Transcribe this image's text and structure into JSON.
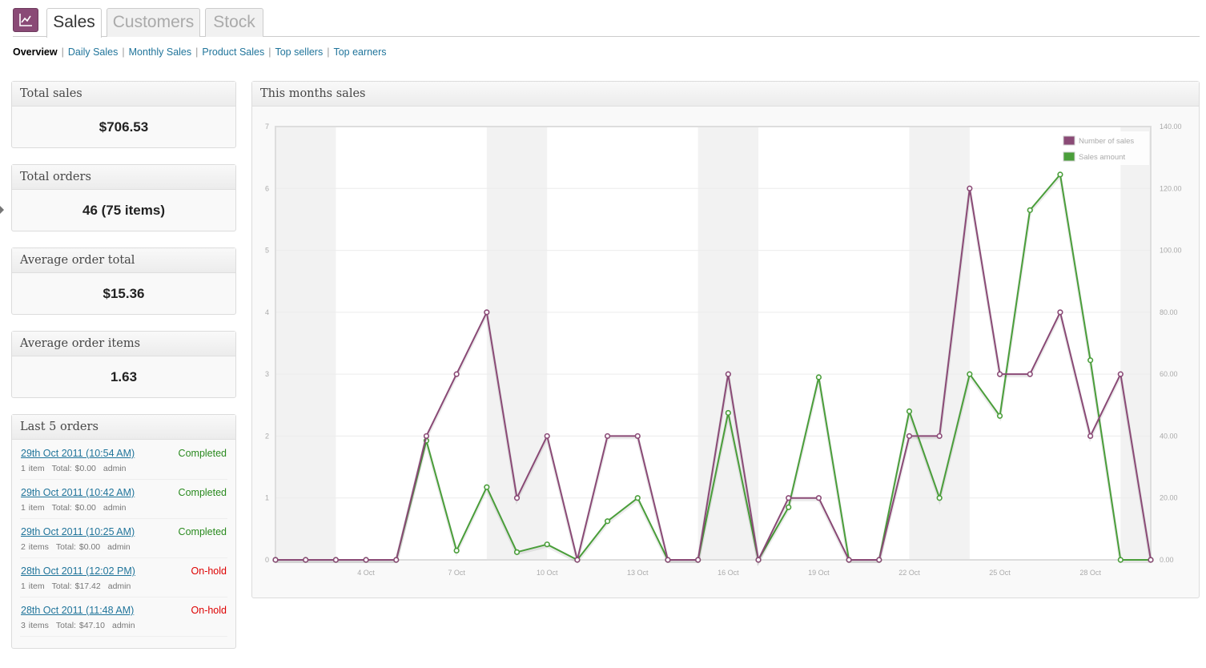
{
  "tabs": [
    {
      "label": "Sales",
      "active": true
    },
    {
      "label": "Customers",
      "active": false
    },
    {
      "label": "Stock",
      "active": false
    }
  ],
  "app_icon": "chart-icon",
  "subnav": [
    "Overview",
    "Daily Sales",
    "Monthly Sales",
    "Product Sales",
    "Top sellers",
    "Top earners"
  ],
  "stats": [
    {
      "title": "Total sales",
      "value": "$706.53"
    },
    {
      "title": "Total orders",
      "value": "46 (75 items)"
    },
    {
      "title": "Average order total",
      "value": "$15.36"
    },
    {
      "title": "Average order items",
      "value": "1.63"
    }
  ],
  "last_orders": {
    "title": "Last 5 orders",
    "orders": [
      {
        "link": "29th Oct 2011 (10:54 AM)",
        "items": "1 item",
        "total": "Total: $0.00",
        "user": "admin",
        "status": "Completed"
      },
      {
        "link": "29th Oct 2011 (10:42 AM)",
        "items": "1 item",
        "total": "Total: $0.00",
        "user": "admin",
        "status": "Completed"
      },
      {
        "link": "29th Oct 2011 (10:25 AM)",
        "items": "2 items",
        "total": "Total: $0.00",
        "user": "admin",
        "status": "Completed"
      },
      {
        "link": "28th Oct 2011 (12:02 PM)",
        "items": "1 item",
        "total": "Total: $17.42",
        "user": "admin",
        "status": "On-hold"
      },
      {
        "link": "28th Oct 2011 (11:48 AM)",
        "items": "3 items",
        "total": "Total: $47.10",
        "user": "admin",
        "status": "On-hold"
      }
    ]
  },
  "colors": {
    "accent": "#8a4a76",
    "number_of_sales": "#8a4a76",
    "sales_amount": "#4a9e3a",
    "completed": "#2a8a1f",
    "onhold": "#d00000",
    "link": "#21759b"
  },
  "chart_title": "This months sales",
  "chart_data": {
    "type": "line",
    "x_days": [
      1,
      2,
      3,
      4,
      5,
      6,
      7,
      8,
      9,
      10,
      11,
      12,
      13,
      14,
      15,
      16,
      17,
      18,
      19,
      20,
      21,
      22,
      23,
      24,
      25,
      26,
      27,
      28,
      29,
      30
    ],
    "x_tick_labels": [
      "4 Oct",
      "7 Oct",
      "10 Oct",
      "13 Oct",
      "16 Oct",
      "19 Oct",
      "22 Oct",
      "25 Oct",
      "28 Oct"
    ],
    "x_tick_days": [
      4,
      7,
      10,
      13,
      16,
      19,
      22,
      25,
      28
    ],
    "weekend_bands": [
      [
        1,
        3
      ],
      [
        8,
        10
      ],
      [
        15,
        17
      ],
      [
        22,
        24
      ],
      [
        29,
        31
      ]
    ],
    "series": [
      {
        "name": "Number of sales",
        "axis": "left",
        "values": [
          0,
          0,
          0,
          0,
          0,
          2,
          3,
          4,
          1,
          2,
          0,
          2,
          2,
          0,
          0,
          3,
          0,
          1,
          1,
          0,
          0,
          2,
          2,
          6,
          3,
          3,
          4,
          2,
          3,
          0
        ]
      },
      {
        "name": "Sales amount",
        "axis": "right",
        "values": [
          0,
          0,
          0,
          0,
          0,
          38.5,
          3,
          23.5,
          2.5,
          5,
          0,
          12.5,
          20,
          0,
          0,
          47.5,
          0,
          17,
          59,
          0,
          0,
          48,
          20,
          60,
          46.5,
          113,
          124.5,
          64.5,
          0,
          0
        ]
      }
    ],
    "y_left": {
      "min": 0,
      "max": 7,
      "ticks": [
        "0",
        "1",
        "2",
        "3",
        "4",
        "5",
        "6",
        "7"
      ]
    },
    "y_right": {
      "min": 0,
      "max": 140,
      "ticks": [
        "0.00",
        "20.00",
        "40.00",
        "60.00",
        "80.00",
        "100.00",
        "120.00",
        "140.00"
      ]
    },
    "legend": "top-right"
  }
}
